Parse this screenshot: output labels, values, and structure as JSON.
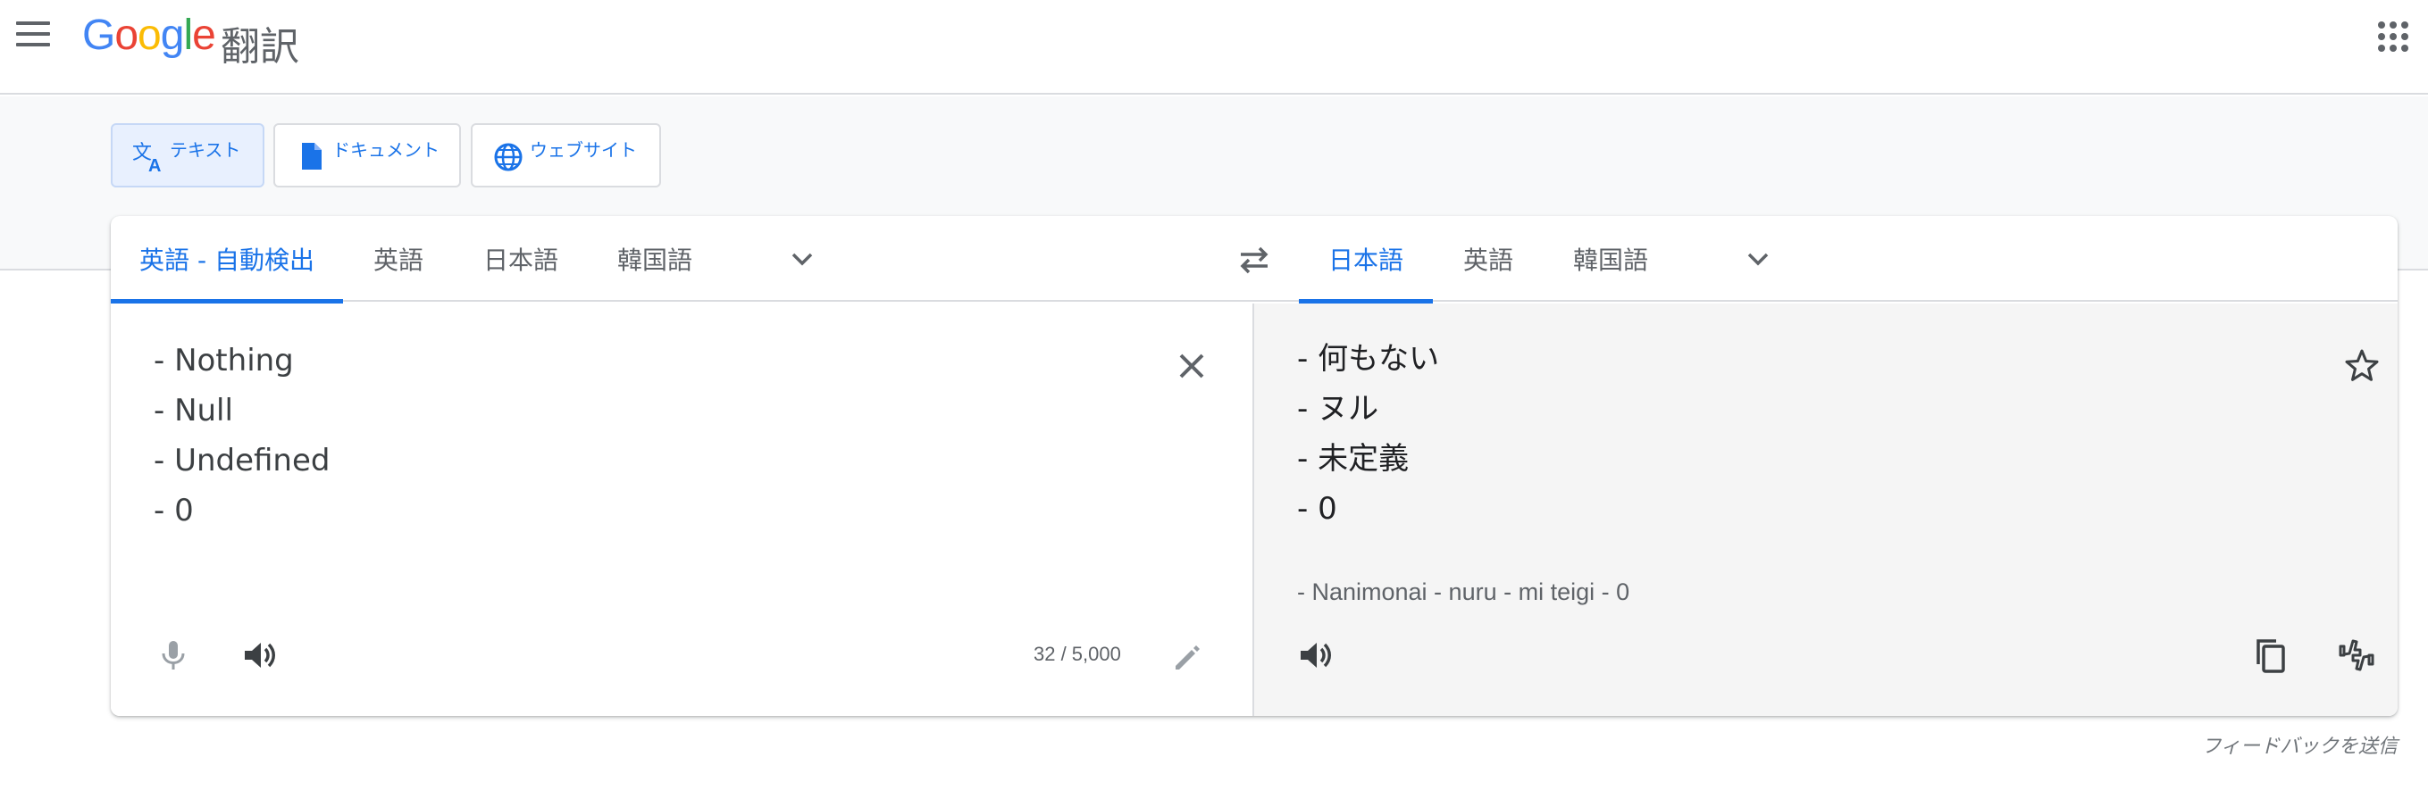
{
  "header": {
    "logo_letters": [
      "G",
      "o",
      "o",
      "g",
      "l",
      "e"
    ],
    "logo_text": "Google",
    "product": "翻訳",
    "menu_icon": "hamburger-menu-icon",
    "apps_icon": "apps-grid-icon"
  },
  "modes": [
    {
      "label": "テキスト",
      "icon": "translate-icon",
      "active": true
    },
    {
      "label": "ドキュメント",
      "icon": "document-icon",
      "active": false
    },
    {
      "label": "ウェブサイト",
      "icon": "globe-icon",
      "active": false
    }
  ],
  "source": {
    "tabs": [
      {
        "label": "英語 - 自動検出",
        "active": true
      },
      {
        "label": "英語",
        "active": false
      },
      {
        "label": "日本語",
        "active": false
      },
      {
        "label": "韓国語",
        "active": false
      }
    ],
    "lines": [
      "- Nothing",
      "- Null",
      "- Undefined",
      "- 0"
    ],
    "char_count": "32 / 5,000"
  },
  "target": {
    "tabs": [
      {
        "label": "日本語",
        "active": true
      },
      {
        "label": "英語",
        "active": false
      },
      {
        "label": "韓国語",
        "active": false
      }
    ],
    "lines": [
      "- 何もない",
      "- ヌル",
      "- 未定義",
      "- 0"
    ],
    "romanization": "- Nanimonai - nuru - mi teigi - 0"
  },
  "feedback_link": "フィードバックを送信",
  "colors": {
    "accent": "#1a73e8",
    "band": "#f8f9fa",
    "target_pane": "#f5f5f5",
    "active_mode_bg": "#e8f0fe"
  }
}
